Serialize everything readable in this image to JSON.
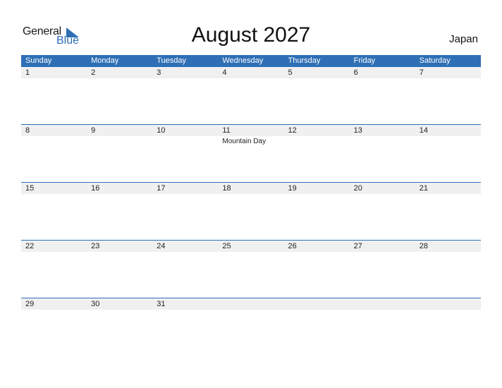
{
  "logo": {
    "line1": "General",
    "line2": "Blue"
  },
  "title": "August 2027",
  "country": "Japan",
  "colors": {
    "accent": "#2e6fb5",
    "date_row_bg": "#f0f0f0"
  },
  "weekdays": [
    "Sunday",
    "Monday",
    "Tuesday",
    "Wednesday",
    "Thursday",
    "Friday",
    "Saturday"
  ],
  "weeks": [
    {
      "days": [
        "1",
        "2",
        "3",
        "4",
        "5",
        "6",
        "7"
      ],
      "events": [
        "",
        "",
        "",
        "",
        "",
        "",
        ""
      ]
    },
    {
      "days": [
        "8",
        "9",
        "10",
        "11",
        "12",
        "13",
        "14"
      ],
      "events": [
        "",
        "",
        "",
        "Mountain Day",
        "",
        "",
        ""
      ]
    },
    {
      "days": [
        "15",
        "16",
        "17",
        "18",
        "19",
        "20",
        "21"
      ],
      "events": [
        "",
        "",
        "",
        "",
        "",
        "",
        ""
      ]
    },
    {
      "days": [
        "22",
        "23",
        "24",
        "25",
        "26",
        "27",
        "28"
      ],
      "events": [
        "",
        "",
        "",
        "",
        "",
        "",
        ""
      ]
    },
    {
      "days": [
        "29",
        "30",
        "31",
        "",
        "",
        "",
        ""
      ],
      "events": [
        "",
        "",
        "",
        "",
        "",
        "",
        ""
      ]
    }
  ]
}
